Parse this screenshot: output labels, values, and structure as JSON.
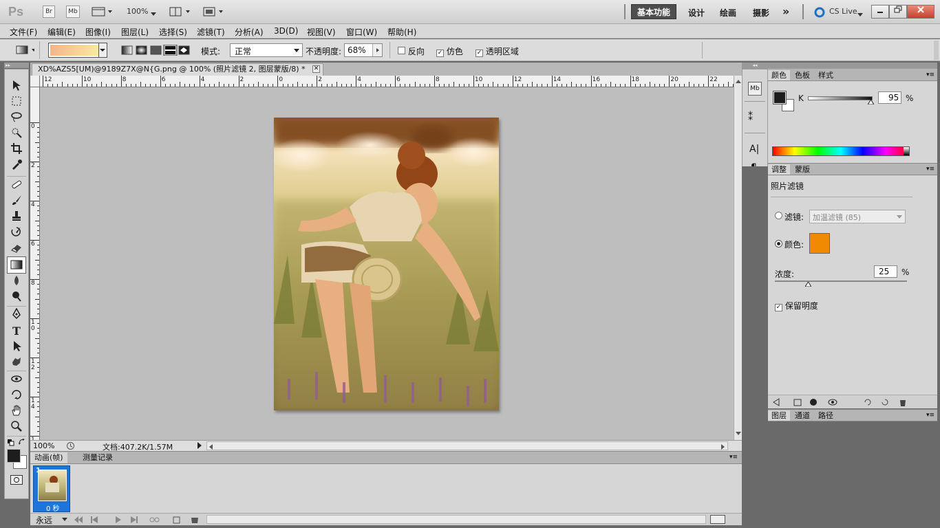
{
  "titlebar": {
    "app_logo": "Ps",
    "br_label": "Br",
    "mb_label": "Mb",
    "zoom": "100%",
    "workspaces": [
      "基本功能",
      "设计",
      "绘画",
      "摄影"
    ],
    "more": "»",
    "cslive": "CS Live"
  },
  "menu": [
    "文件(F)",
    "编辑(E)",
    "图像(I)",
    "图层(L)",
    "选择(S)",
    "滤镜(T)",
    "分析(A)",
    "3D(D)",
    "视图(V)",
    "窗口(W)",
    "帮助(H)"
  ],
  "options": {
    "mode_label": "模式:",
    "mode_value": "正常",
    "opacity_label": "不透明度:",
    "opacity_value": "68%",
    "reverse_label": "反向",
    "dither_label": "仿色",
    "transparency_label": "透明区域"
  },
  "document": {
    "tab_title": "XD%AZS5[UM)@9189Z7X@N{G.png @ 100% (照片滤镜 2, 图层蒙版/8) *",
    "zoom": "100%",
    "doc_info": "文档:407.2K/1.57M"
  },
  "ruler_top": [
    "12",
    "10",
    "8",
    "6",
    "4",
    "2",
    "0",
    "2",
    "4",
    "6",
    "8",
    "10",
    "12",
    "14",
    "16",
    "18",
    "20",
    "22"
  ],
  "ruler_left": [
    "0",
    "2",
    "4",
    "6",
    "8",
    "1\n0",
    "1\n2",
    "1\n4",
    "1\n6"
  ],
  "anim_panel": {
    "tabs": [
      "动画(帧)",
      "测量记录"
    ],
    "frame_number": "1",
    "frame_time": "0 秒",
    "loop": "永远"
  },
  "color_panel": {
    "tabs": [
      "颜色",
      "色板",
      "样式"
    ],
    "channel": "K",
    "value": "95",
    "percent": "%"
  },
  "adjust_panel": {
    "tabs": [
      "调整",
      "蒙版"
    ],
    "title": "照片滤镜",
    "filter_label": "滤镜:",
    "filter_value": "加温滤镜 (85)",
    "color_label": "颜色:",
    "color_swatch": "#f08a00",
    "density_label": "浓度:",
    "density_value": "25",
    "density_unit": "%",
    "preserve_label": "保留明度"
  },
  "layers_panel": {
    "tabs": [
      "图层",
      "通道",
      "路径"
    ]
  }
}
